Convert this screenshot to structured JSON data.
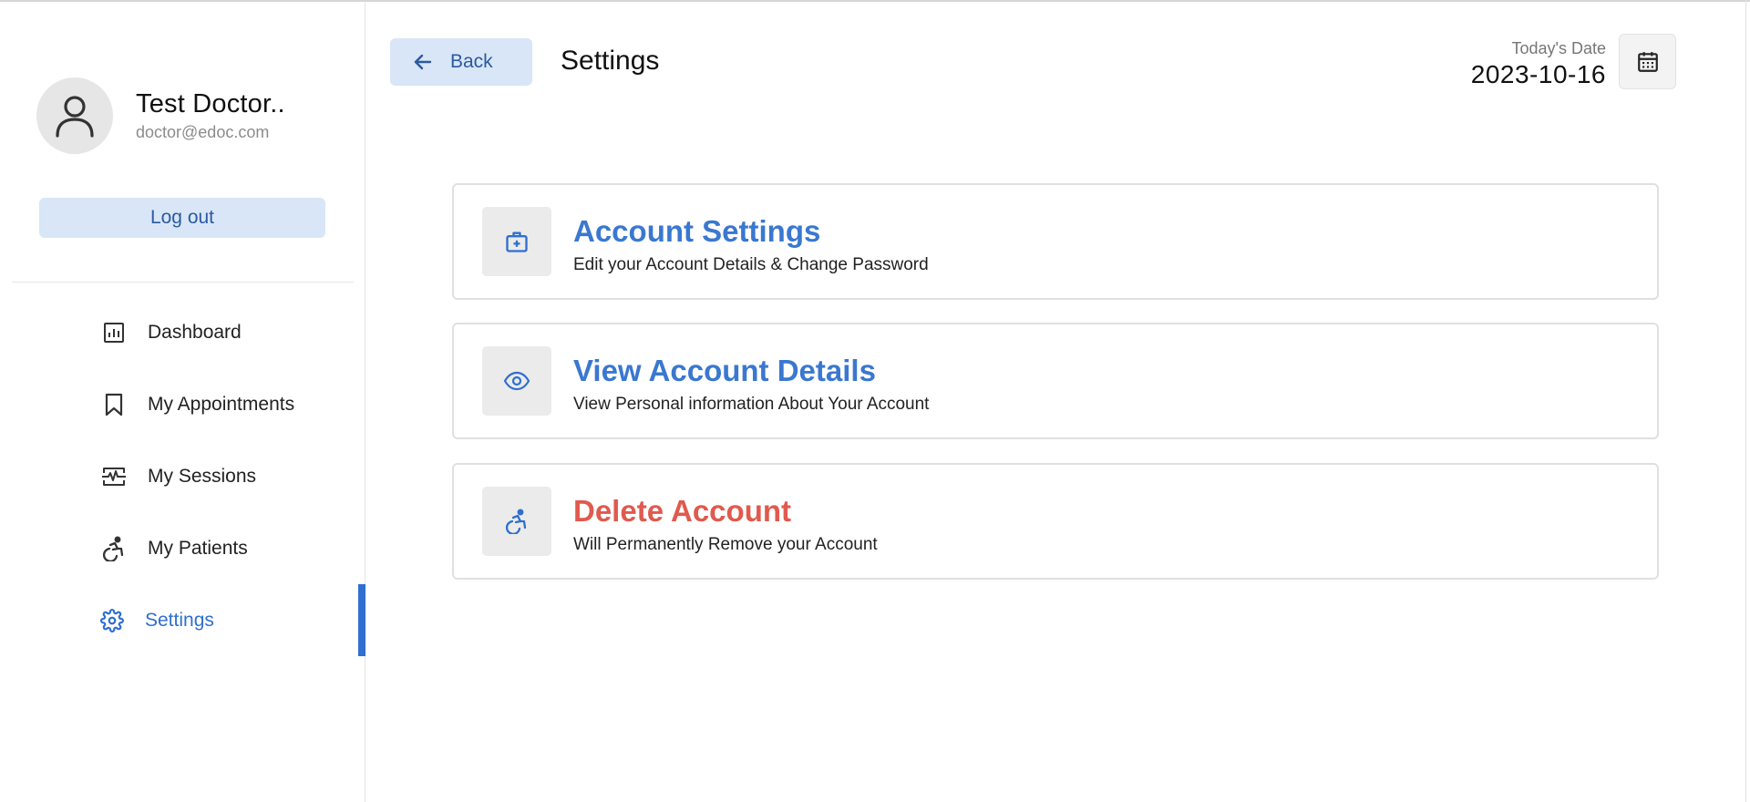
{
  "profile": {
    "name": "Test Doctor..",
    "email": "doctor@edoc.com",
    "logout_label": "Log out"
  },
  "nav": {
    "items": [
      {
        "label": "Dashboard",
        "icon": "dashboard-icon"
      },
      {
        "label": "My Appointments",
        "icon": "bookmark-icon"
      },
      {
        "label": "My Sessions",
        "icon": "sessions-icon"
      },
      {
        "label": "My Patients",
        "icon": "accessibility-icon"
      },
      {
        "label": "Settings",
        "icon": "gear-icon",
        "active": true
      }
    ]
  },
  "header": {
    "back_label": "Back",
    "title": "Settings",
    "date_label": "Today's Date",
    "date_value": "2023-10-16"
  },
  "cards": [
    {
      "title": "Account Settings",
      "description": "Edit your Account Details & Change Password",
      "icon": "medical-bag-icon"
    },
    {
      "title": "View Account Details",
      "description": "View Personal information About Your Account",
      "icon": "eye-icon"
    },
    {
      "title": "Delete Account",
      "description": "Will Permanently Remove your Account",
      "icon": "wheelchair-icon",
      "danger": true
    }
  ],
  "colors": {
    "accent": "#2f6fcf",
    "accent_light": "#d8e6f7",
    "danger": "#e05a4e"
  }
}
